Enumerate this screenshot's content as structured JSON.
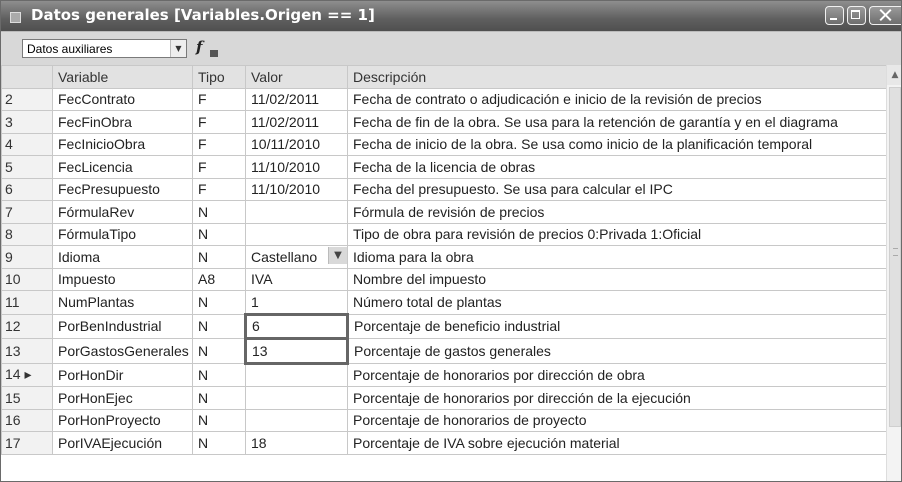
{
  "window": {
    "title": "Datos generales [Variables.Origen == 1]"
  },
  "toolbar": {
    "combo_value": "Datos auxiliares",
    "fx_label": "f"
  },
  "table": {
    "columns": [
      "Variable",
      "Tipo",
      "Valor",
      "Descripción"
    ],
    "current_marker": "▸",
    "rows": [
      {
        "n": "2",
        "variable": "FecContrato",
        "tipo": "F",
        "valor": "11/02/2011",
        "descripcion": "Fecha de contrato o adjudicación e inicio de la revisión de precios"
      },
      {
        "n": "3",
        "variable": "FecFinObra",
        "tipo": "F",
        "valor": "11/02/2011",
        "descripcion": "Fecha de fin de la obra. Se usa para la retención de garantía y en el diagrama"
      },
      {
        "n": "4",
        "variable": "FecInicioObra",
        "tipo": "F",
        "valor": "10/11/2010",
        "descripcion": "Fecha de inicio de la obra. Se usa como inicio de la planificación temporal"
      },
      {
        "n": "5",
        "variable": "FecLicencia",
        "tipo": "F",
        "valor": "11/10/2010",
        "descripcion": "Fecha de la licencia de obras"
      },
      {
        "n": "6",
        "variable": "FecPresupuesto",
        "tipo": "F",
        "valor": "11/10/2010",
        "descripcion": "Fecha del presupuesto. Se usa para calcular el IPC"
      },
      {
        "n": "7",
        "variable": "FórmulaRev",
        "tipo": "N",
        "valor": "",
        "descripcion": "Fórmula de revisión de precios"
      },
      {
        "n": "8",
        "variable": "FórmulaTipo",
        "tipo": "N",
        "valor": "",
        "descripcion": "Tipo de obra para revisión de precios 0:Privada 1:Oficial"
      },
      {
        "n": "9",
        "variable": "Idioma",
        "tipo": "N",
        "valor": "Castellano",
        "descripcion": "Idioma para la obra"
      },
      {
        "n": "10",
        "variable": "Impuesto",
        "tipo": "A8",
        "valor": "IVA",
        "descripcion": "Nombre del impuesto"
      },
      {
        "n": "11",
        "variable": "NumPlantas",
        "tipo": "N",
        "valor": "1",
        "descripcion": "Número total de plantas"
      },
      {
        "n": "12",
        "variable": "PorBenIndustrial",
        "tipo": "N",
        "valor": "6",
        "descripcion": "Porcentaje de beneficio industrial"
      },
      {
        "n": "13",
        "variable": "PorGastosGenerales",
        "tipo": "N",
        "valor": "13",
        "descripcion": "Porcentaje de gastos generales"
      },
      {
        "n": "14",
        "variable": "PorHonDir",
        "tipo": "N",
        "valor": "",
        "descripcion": "Porcentaje de honorarios por dirección de obra"
      },
      {
        "n": "15",
        "variable": "PorHonEjec",
        "tipo": "N",
        "valor": "",
        "descripcion": "Porcentaje de honorarios por dirección de la ejecución"
      },
      {
        "n": "16",
        "variable": "PorHonProyecto",
        "tipo": "N",
        "valor": "",
        "descripcion": "Porcentaje de honorarios de proyecto"
      },
      {
        "n": "17",
        "variable": "PorIVAEjecución",
        "tipo": "N",
        "valor": "18",
        "descripcion": "Porcentaje de IVA sobre ejecución material"
      }
    ]
  }
}
